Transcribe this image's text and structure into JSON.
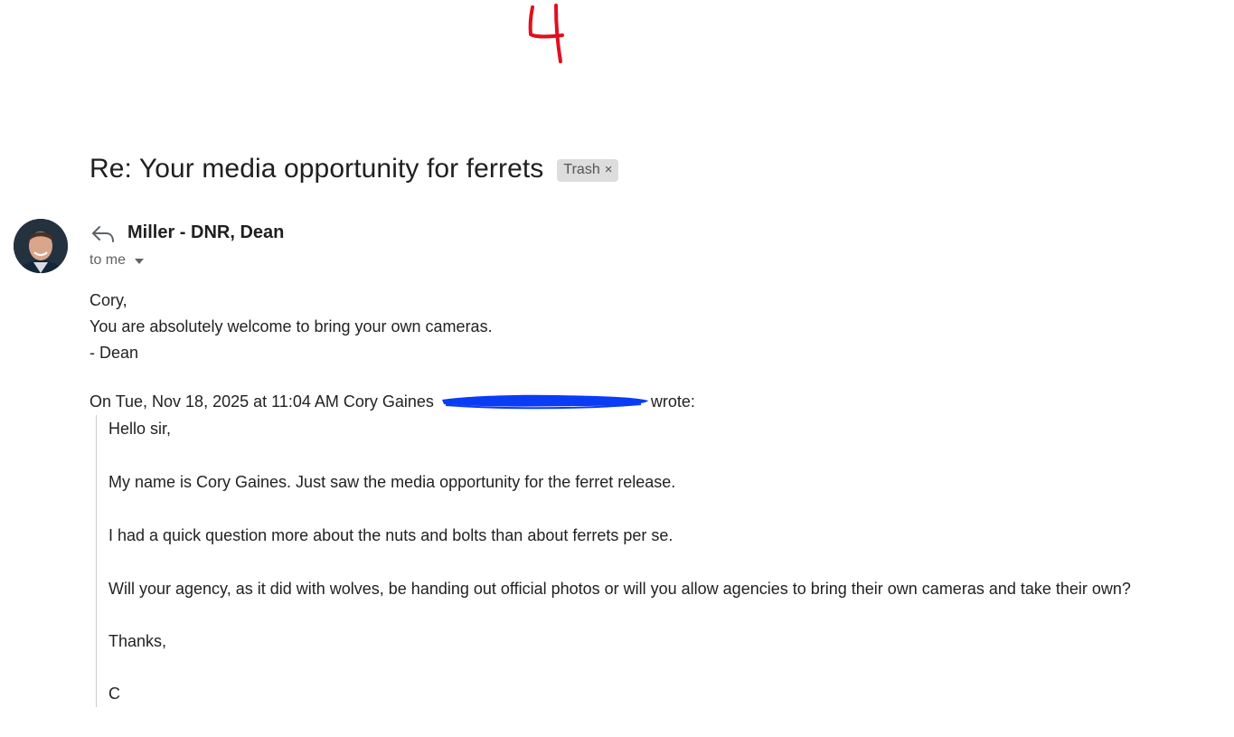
{
  "annotation": "4",
  "thread": {
    "subject": "Re: Your media opportunity for ferrets",
    "label": "Trash",
    "label_close": "×"
  },
  "message": {
    "sender_name": "Miller - DNR, Dean",
    "recipient_text": "to me",
    "body_lines": [
      "Cory,",
      "You are absolutely welcome to bring your own cameras.",
      "- Dean"
    ]
  },
  "quoted": {
    "header_prefix": "On Tue, Nov 18, 2025 at 11:04 AM Cory Gaines",
    "header_suffix": "wrote:",
    "lines": [
      "Hello sir,",
      "My name is Cory Gaines.  Just saw the media opportunity for the ferret release.",
      "I had a quick question more about the nuts and bolts than about ferrets per se.",
      "Will your agency, as it did with wolves, be handing out official photos or will you allow agencies to bring their own cameras and take their own?",
      "Thanks,",
      "C"
    ]
  },
  "colors": {
    "annotation": "#e0101e",
    "redaction": "#0a3cf5",
    "label_bg": "#dddddd",
    "quote_border": "#cccccc"
  }
}
